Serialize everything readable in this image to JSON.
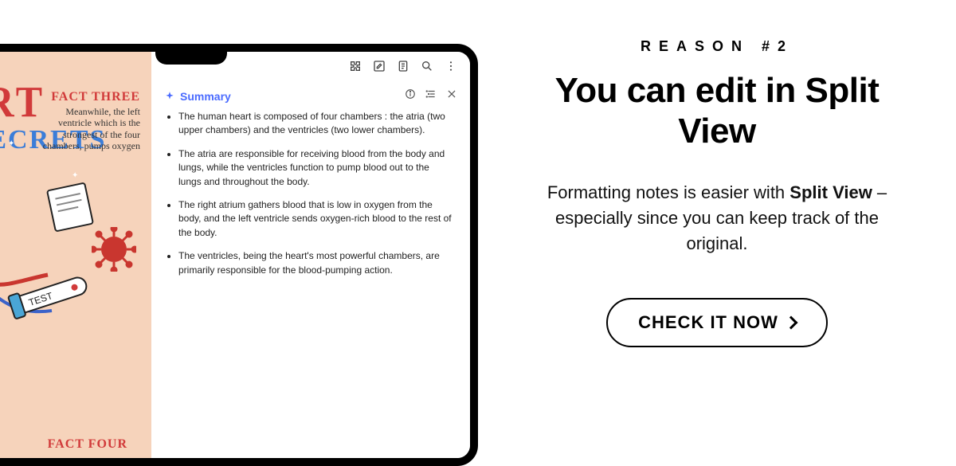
{
  "eyebrow": "REASON #2",
  "headline": "You can edit in Split View",
  "body_pre": "Formatting notes is easier with ",
  "body_bold": "Split View",
  "body_post": " – especially since you can keep track of the original.",
  "cta_label": "CHECK IT NOW",
  "device": {
    "illustration": {
      "title_line1": "EART",
      "title_line2": "OF SECRETS",
      "fact3_label": "FACT THREE",
      "fact3_text": "Meanwhile, the left ventricle which is the strongest of the four chambers, pumps oxygen",
      "fact4_label": "FACT FOUR",
      "test_label": "TEST"
    },
    "summary": {
      "title": "Summary",
      "bullets": [
        "The human heart is composed of four chambers : the atria (two upper chambers) and the ventricles (two lower chambers).",
        "The atria are responsible for receiving blood from the body and lungs, while the ventricles function to pump blood out to the lungs and throughout the body.",
        "The right atrium gathers blood that is low in oxygen from the body, and the left ventricle sends oxygen-rich blood to the rest of the body.",
        "The ventricles, being the heart's most powerful chambers, are primarily responsible for the blood-pumping action."
      ]
    }
  }
}
